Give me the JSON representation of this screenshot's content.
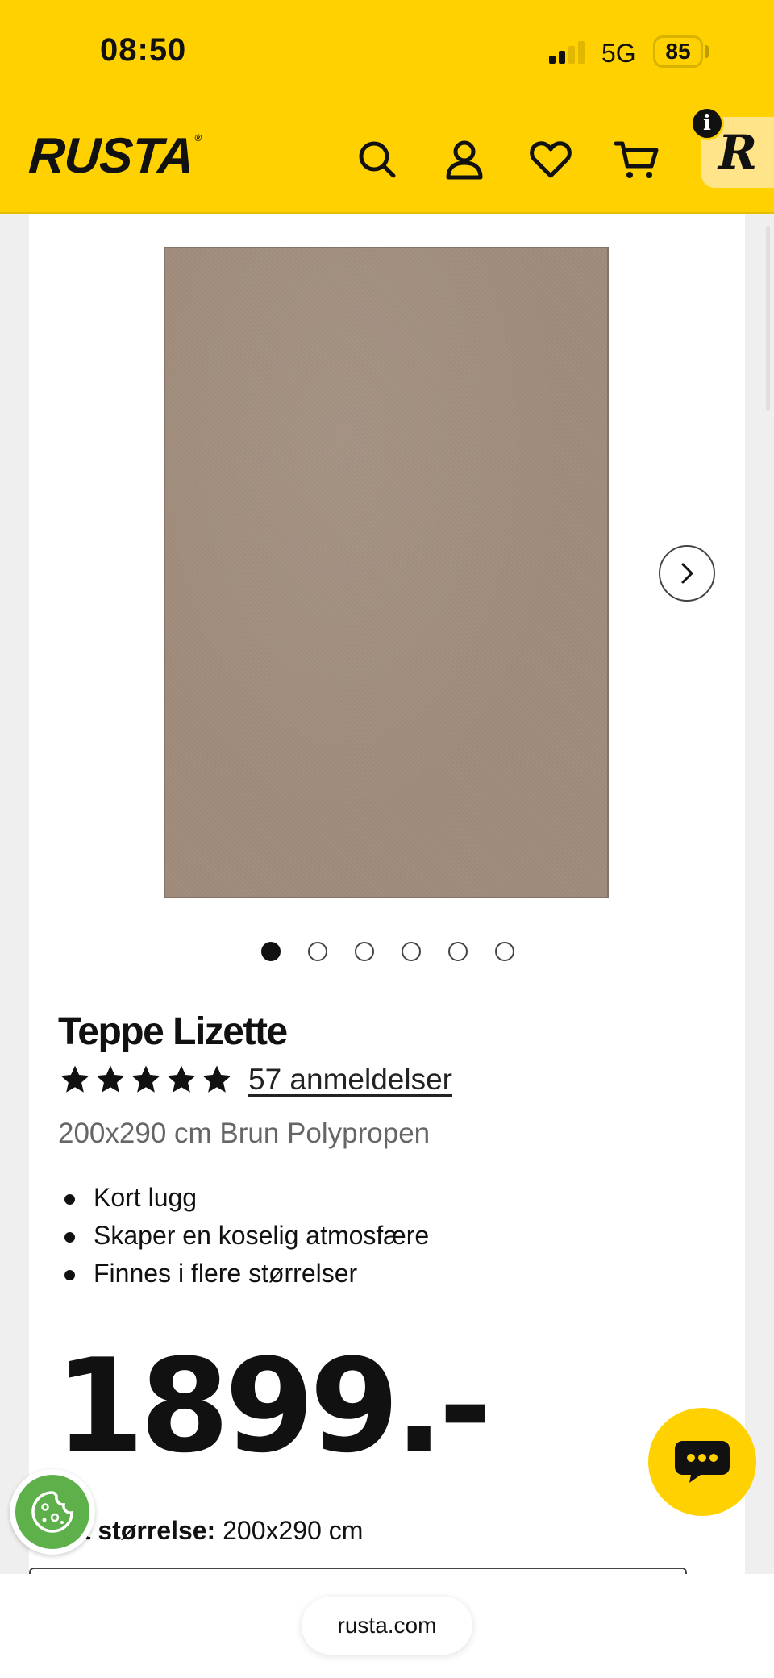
{
  "status_bar": {
    "time": "08:50",
    "network": "5G",
    "battery": "85"
  },
  "header": {
    "logo": "RUSTA",
    "logo_mark": "®",
    "icons": [
      "search-icon",
      "account-icon",
      "heart-icon",
      "cart-icon"
    ],
    "rewards_letter": "R",
    "info_letter": "i",
    "brand_color": "#ffd100"
  },
  "gallery": {
    "image_alt": "Teppe Lizette",
    "slide_count": 6,
    "active_slide": 1
  },
  "product": {
    "title": "Teppe Lizette",
    "rating": 5,
    "reviews_label": "57 anmeldelser",
    "subtitle": "200x290 cm Brun Polypropen",
    "features": [
      "Kort lugg",
      "Skaper en koselig atmosfære",
      "Finnes i flere størrelser"
    ],
    "price": "1899.-",
    "size_label": "Valgt størrelse:",
    "size_value": "200x290 cm"
  },
  "browser": {
    "url": "rusta.com"
  }
}
